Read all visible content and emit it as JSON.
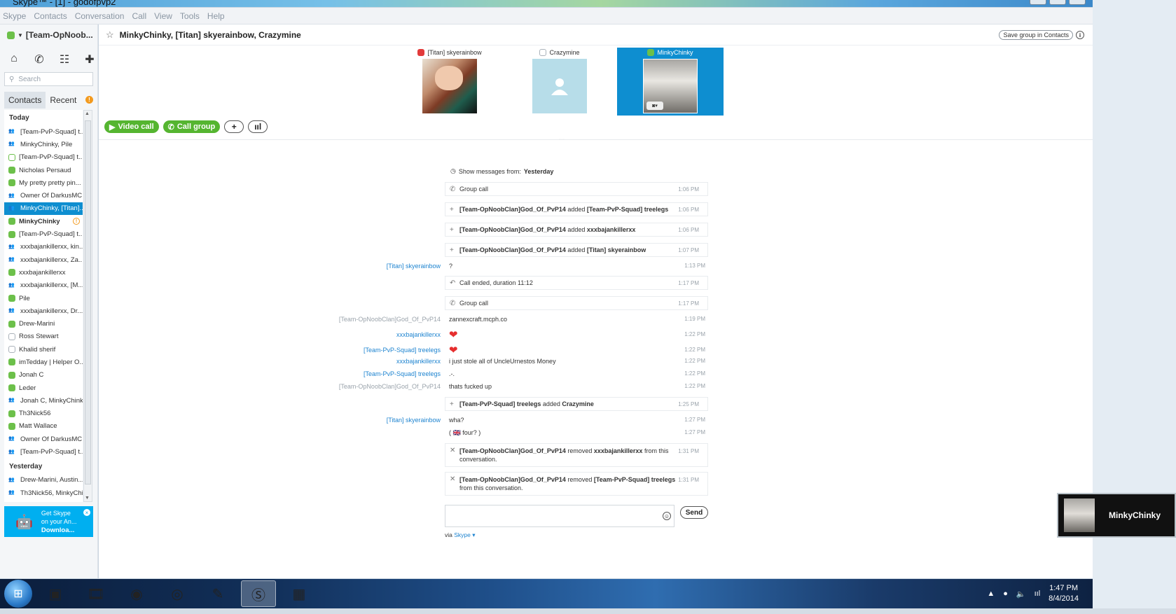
{
  "window": {
    "title": "Skype™ - [1] - godofpvp2"
  },
  "menu": [
    "Skype",
    "Contacts",
    "Conversation",
    "Call",
    "View",
    "Tools",
    "Help"
  ],
  "profile": {
    "name": "[Team-OpNoob..."
  },
  "search": {
    "placeholder": "Search"
  },
  "tabs": {
    "contacts": "Contacts",
    "recent": "Recent",
    "alert": "!"
  },
  "sections": {
    "today": "Today",
    "yesterday": "Yesterday"
  },
  "recent_today": [
    {
      "name": "[Team-PvP-Squad] t...",
      "icon": "grp"
    },
    {
      "name": "MinkyChinky, Pile",
      "icon": "grp"
    },
    {
      "name": "[Team-PvP-Squad] t...",
      "icon": "away"
    },
    {
      "name": "Nicholas Persaud",
      "icon": "on"
    },
    {
      "name": "My pretty pretty pin...",
      "icon": "on"
    },
    {
      "name": "Owner Of DarkusMC...",
      "icon": "grp"
    },
    {
      "name": "MinkyChinky, [Titan]...",
      "icon": "grp",
      "selected": true
    },
    {
      "name": "MinkyChinky",
      "icon": "on",
      "bold": true,
      "badge": "!"
    },
    {
      "name": "[Team-PvP-Squad] t...",
      "icon": "on"
    },
    {
      "name": "xxxbajankillerxx, kin...",
      "icon": "grp"
    },
    {
      "name": "xxxbajankillerxx, Za...",
      "icon": "grp"
    },
    {
      "name": "xxxbajankillerxx",
      "icon": "on"
    },
    {
      "name": "xxxbajankillerxx, [M...",
      "icon": "grp"
    },
    {
      "name": "Pile",
      "icon": "on"
    },
    {
      "name": "xxxbajankillerxx, Dr...",
      "icon": "grp"
    },
    {
      "name": "Drew-Marini",
      "icon": "on"
    },
    {
      "name": "Ross Stewart",
      "icon": "off"
    },
    {
      "name": "Khalid sherif",
      "icon": "off"
    },
    {
      "name": "imTedday | Helper O...",
      "icon": "on"
    },
    {
      "name": "Jonah C",
      "icon": "on"
    },
    {
      "name": "Leder",
      "icon": "on"
    },
    {
      "name": "Jonah C, MinkyChink...",
      "icon": "grp"
    },
    {
      "name": "Th3Nick56",
      "icon": "on"
    },
    {
      "name": "Matt Wallace",
      "icon": "on"
    },
    {
      "name": "Owner Of DarkusMC...",
      "icon": "grp"
    },
    {
      "name": "[Team-PvP-Squad] t...",
      "icon": "grp"
    }
  ],
  "recent_yesterday": [
    {
      "name": "Drew-Marini, Austin...",
      "icon": "grp"
    },
    {
      "name": "Th3Nick56, MinkyChi...",
      "icon": "grp"
    }
  ],
  "promo": {
    "line1": "Get Skype",
    "line2": "on your An...",
    "line3": "Downloa...",
    "close": "×"
  },
  "conversation": {
    "title": "MinkyChinky, [Titan] skyerainbow, Crazymine",
    "save_group": "Save group in Contacts",
    "info": "i"
  },
  "participants": [
    {
      "name": "[Titan] skyerainbow"
    },
    {
      "name": "Crazymine"
    },
    {
      "name": "MinkyChinky"
    }
  ],
  "actions": {
    "video_call": "Video call",
    "call_group": "Call group",
    "add": "+",
    "signal": "ııl"
  },
  "more_dots": "...",
  "show_from": {
    "label": "Show messages from:",
    "value": "Yesterday"
  },
  "events": [
    {
      "type": "call",
      "text": "Group call",
      "time": "1:06 PM"
    },
    {
      "type": "add",
      "actor": "[Team-OpNoobClan]God_Of_PvP14",
      "verb": " added ",
      "target": "[Team-PvP-Squad] treelegs",
      "time": "1:06 PM"
    },
    {
      "type": "add",
      "actor": "[Team-OpNoobClan]God_Of_PvP14",
      "verb": " added ",
      "target": "xxxbajankillerxx",
      "time": "1:06 PM"
    },
    {
      "type": "add",
      "actor": "[Team-OpNoobClan]God_Of_PvP14",
      "verb": " added ",
      "target": "[Titan] skyerainbow",
      "time": "1:07 PM"
    },
    {
      "type": "end",
      "text": "Call ended, duration 11:12",
      "time": "1:17 PM"
    },
    {
      "type": "call",
      "text": "Group call",
      "time": "1:17 PM"
    },
    {
      "type": "add",
      "actor": "[Team-PvP-Squad] treelegs",
      "verb": " added ",
      "target": "Crazymine",
      "time": "1:25 PM"
    },
    {
      "type": "remove",
      "actor": "[Team-OpNoobClan]God_Of_PvP14",
      "verb": " removed ",
      "target": "xxxbajankillerxx",
      "suffix": " from this conversation.",
      "time": "1:31 PM"
    },
    {
      "type": "remove",
      "actor": "[Team-OpNoobClan]God_Of_PvP14",
      "verb": " removed ",
      "target": "[Team-PvP-Squad] treelegs",
      "suffix": " from this conversation.",
      "time": "1:31 PM"
    }
  ],
  "messages": [
    {
      "sender": "[Titan] skyerainbow",
      "style": "blue",
      "text": "?",
      "time": "1:13 PM"
    },
    {
      "sender": "[Team-OpNoobClan]God_Of_PvP14",
      "style": "grey",
      "text": "zannexcraft.mcph.co",
      "time": "1:19 PM"
    },
    {
      "sender": "xxxbajankillerxx",
      "style": "blue",
      "text": "",
      "heart": "❤",
      "time": "1:22 PM"
    },
    {
      "sender": "[Team-PvP-Squad] treelegs",
      "style": "blue",
      "text": "",
      "heart": "❤",
      "time": "1:22 PM"
    },
    {
      "sender": "xxxbajankillerxx",
      "style": "blue",
      "text": "i just stole all of UncleUrnestos Money",
      "time": "1:22 PM"
    },
    {
      "sender": "[Team-PvP-Squad] treelegs",
      "style": "blue",
      "text": ".-.",
      "time": "1:22 PM"
    },
    {
      "sender": "[Team-OpNoobClan]God_Of_PvP14",
      "style": "grey",
      "text": "thats fucked up",
      "time": "1:22 PM"
    },
    {
      "sender": "[Titan] skyerainbow",
      "style": "blue",
      "text": "wha?",
      "time": "1:27 PM"
    },
    {
      "sender": "",
      "style": "blue",
      "text": "( 🇬🇧 four? )",
      "time": "1:27 PM"
    }
  ],
  "composer": {
    "send": "Send",
    "via_label": "via ",
    "via_link": "Skype ▾",
    "emoticon": "☺"
  },
  "popup": {
    "name": "MinkyChinky"
  },
  "taskbar": {
    "time": "1:47 PM",
    "date": "8/4/2014"
  },
  "colors": {
    "skype_blue": "#00aff0",
    "selection_blue": "#0e8ed0",
    "online_green": "#6cc04a",
    "call_green": "#55b530",
    "link_blue": "#1e84d0"
  }
}
